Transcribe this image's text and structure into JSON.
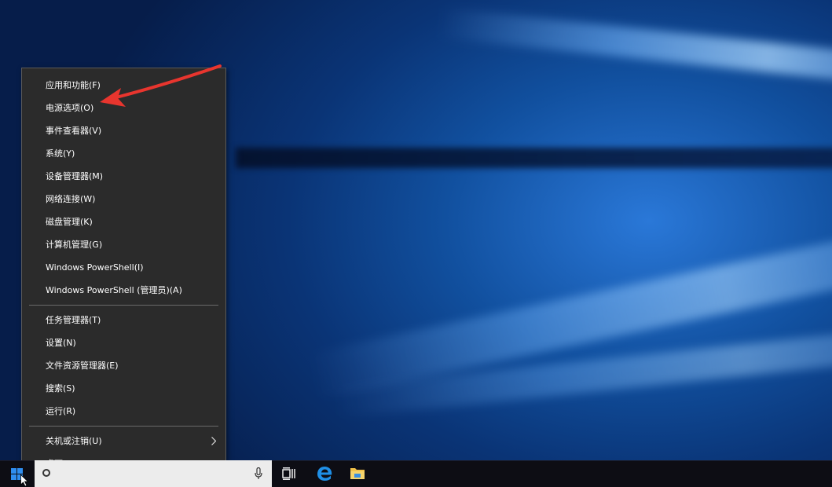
{
  "menu": {
    "group1": [
      {
        "label": "应用和功能(F)"
      },
      {
        "label": "电源选项(O)"
      },
      {
        "label": "事件查看器(V)"
      },
      {
        "label": "系统(Y)"
      },
      {
        "label": "设备管理器(M)"
      },
      {
        "label": "网络连接(W)"
      },
      {
        "label": "磁盘管理(K)"
      },
      {
        "label": "计算机管理(G)"
      },
      {
        "label": "Windows PowerShell(I)"
      },
      {
        "label": "Windows PowerShell (管理员)(A)"
      }
    ],
    "group2": [
      {
        "label": "任务管理器(T)"
      },
      {
        "label": "设置(N)"
      },
      {
        "label": "文件资源管理器(E)"
      },
      {
        "label": "搜索(S)"
      },
      {
        "label": "运行(R)"
      }
    ],
    "group3": [
      {
        "label": "关机或注销(U)",
        "has_submenu": true
      },
      {
        "label": "桌面(D)"
      }
    ]
  },
  "annotation": {
    "color": "#e8352e",
    "target": "电源选项(O)"
  },
  "taskbar": {
    "icons": [
      "start-windows-icon",
      "search-icon",
      "microphone-icon",
      "task-view-icon",
      "edge-icon",
      "file-explorer-icon"
    ],
    "accent_color": "#0a6cd6"
  }
}
